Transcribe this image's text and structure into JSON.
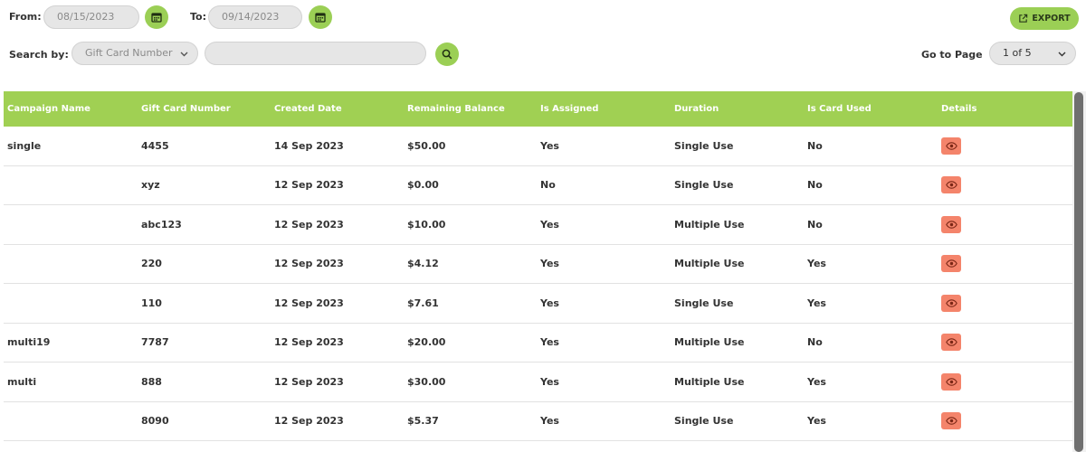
{
  "filters": {
    "from_label": "From:",
    "from_value": "08/15/2023",
    "to_label": "To:",
    "to_value": "09/14/2023",
    "search_label": "Search by:",
    "search_by_value": "Gift Card Number",
    "search_value": "",
    "go_to_page_label": "Go to Page",
    "page_value": "1 of 5",
    "export_label": "EXPORT"
  },
  "colors": {
    "accent": "#a0d053",
    "details_button": "#f4846b"
  },
  "table": {
    "headers": [
      "Campaign Name",
      "Gift Card Number",
      "Created Date",
      "Remaining Balance",
      "Is Assigned",
      "Duration",
      "Is Card Used",
      "Details"
    ],
    "rows": [
      [
        "single",
        "4455",
        "14 Sep 2023",
        "$50.00",
        "Yes",
        "Single Use",
        "No"
      ],
      [
        "",
        "xyz",
        "12 Sep 2023",
        "$0.00",
        "No",
        "Single Use",
        "No"
      ],
      [
        "",
        "abc123",
        "12 Sep 2023",
        "$10.00",
        "Yes",
        "Multiple Use",
        "No"
      ],
      [
        "",
        "220",
        "12 Sep 2023",
        "$4.12",
        "Yes",
        "Multiple Use",
        "Yes"
      ],
      [
        "",
        "110",
        "12 Sep 2023",
        "$7.61",
        "Yes",
        "Single Use",
        "Yes"
      ],
      [
        "multi19",
        "7787",
        "12 Sep 2023",
        "$20.00",
        "Yes",
        "Multiple Use",
        "No"
      ],
      [
        "multi",
        "888",
        "12 Sep 2023",
        "$30.00",
        "Yes",
        "Multiple Use",
        "Yes"
      ],
      [
        "",
        "8090",
        "12 Sep 2023",
        "$5.37",
        "Yes",
        "Single Use",
        "Yes"
      ]
    ]
  }
}
